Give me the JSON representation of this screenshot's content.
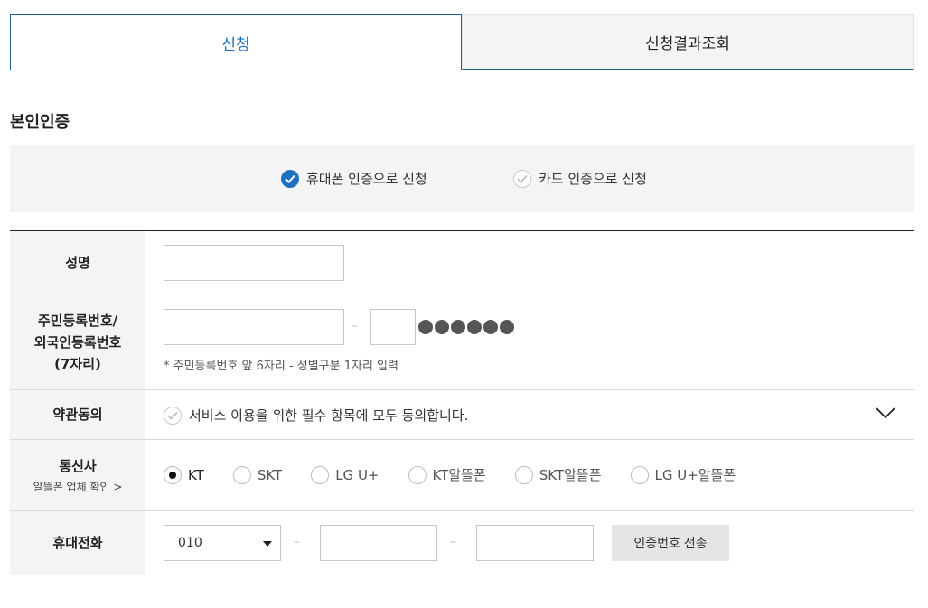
{
  "tabs": [
    {
      "label": "신청",
      "active": true
    },
    {
      "label": "신청결과조회",
      "active": false
    }
  ],
  "section_title": "본인인증",
  "methods": {
    "phone": {
      "label": "휴대폰 인증으로 신청",
      "checked": true
    },
    "card": {
      "label": "카드 인증으로 신청",
      "checked": false
    }
  },
  "form": {
    "name": {
      "label": "성명",
      "value": ""
    },
    "resident": {
      "label_line1": "주민등록번호/",
      "label_line2": "외국인등록번호",
      "label_line3": "(7자리)",
      "front_value": "",
      "back_value": "",
      "note": "* 주민등록번호 앞 6자리 - 성별구분 1자리 입력"
    },
    "terms": {
      "label": "약관동의",
      "agree_text": "서비스 이용을 위한 필수 항목에 모두 동의합니다."
    },
    "carrier": {
      "label": "통신사",
      "sub_link": "알뜰폰 업체 확인 >",
      "options": [
        "KT",
        "SKT",
        "LG U+",
        "KT알뜰폰",
        "SKT알뜰폰",
        "LG U+알뜰폰"
      ],
      "selected": "KT"
    },
    "phone": {
      "label": "휴대전화",
      "prefix": "010",
      "middle": "",
      "last": "",
      "send_button": "인증번호 전송"
    }
  },
  "colors": {
    "accent": "#1d6fc2",
    "tab_border": "#1d5fa0",
    "label_bg": "#f4f4f4"
  }
}
